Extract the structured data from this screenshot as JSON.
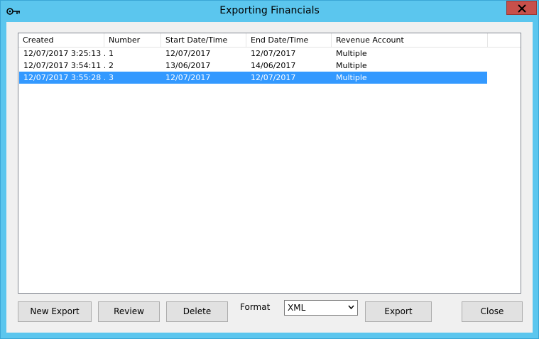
{
  "window": {
    "title": "Exporting Financials",
    "icons": {
      "app": "key-icon",
      "close": "close-icon"
    }
  },
  "list": {
    "columns": [
      "Created",
      "Number",
      "Start Date/Time",
      "End Date/Time",
      "Revenue Account"
    ],
    "rows": [
      {
        "created": "12/07/2017 3:25:13 ...",
        "number": "1",
        "start": "12/07/2017",
        "end": "12/07/2017",
        "account": "Multiple",
        "selected": false
      },
      {
        "created": "12/07/2017 3:54:11 ...",
        "number": "2",
        "start": "13/06/2017",
        "end": "14/06/2017",
        "account": "Multiple",
        "selected": false
      },
      {
        "created": "12/07/2017 3:55:28 ...",
        "number": "3",
        "start": "12/07/2017",
        "end": "12/07/2017",
        "account": "Multiple",
        "selected": true
      }
    ],
    "selection_color": "#3399ff"
  },
  "toolbar": {
    "new_export": "New Export",
    "review": "Review",
    "delete": "Delete",
    "format_label": "Format",
    "format_value": "XML",
    "export": "Export",
    "close": "Close"
  }
}
